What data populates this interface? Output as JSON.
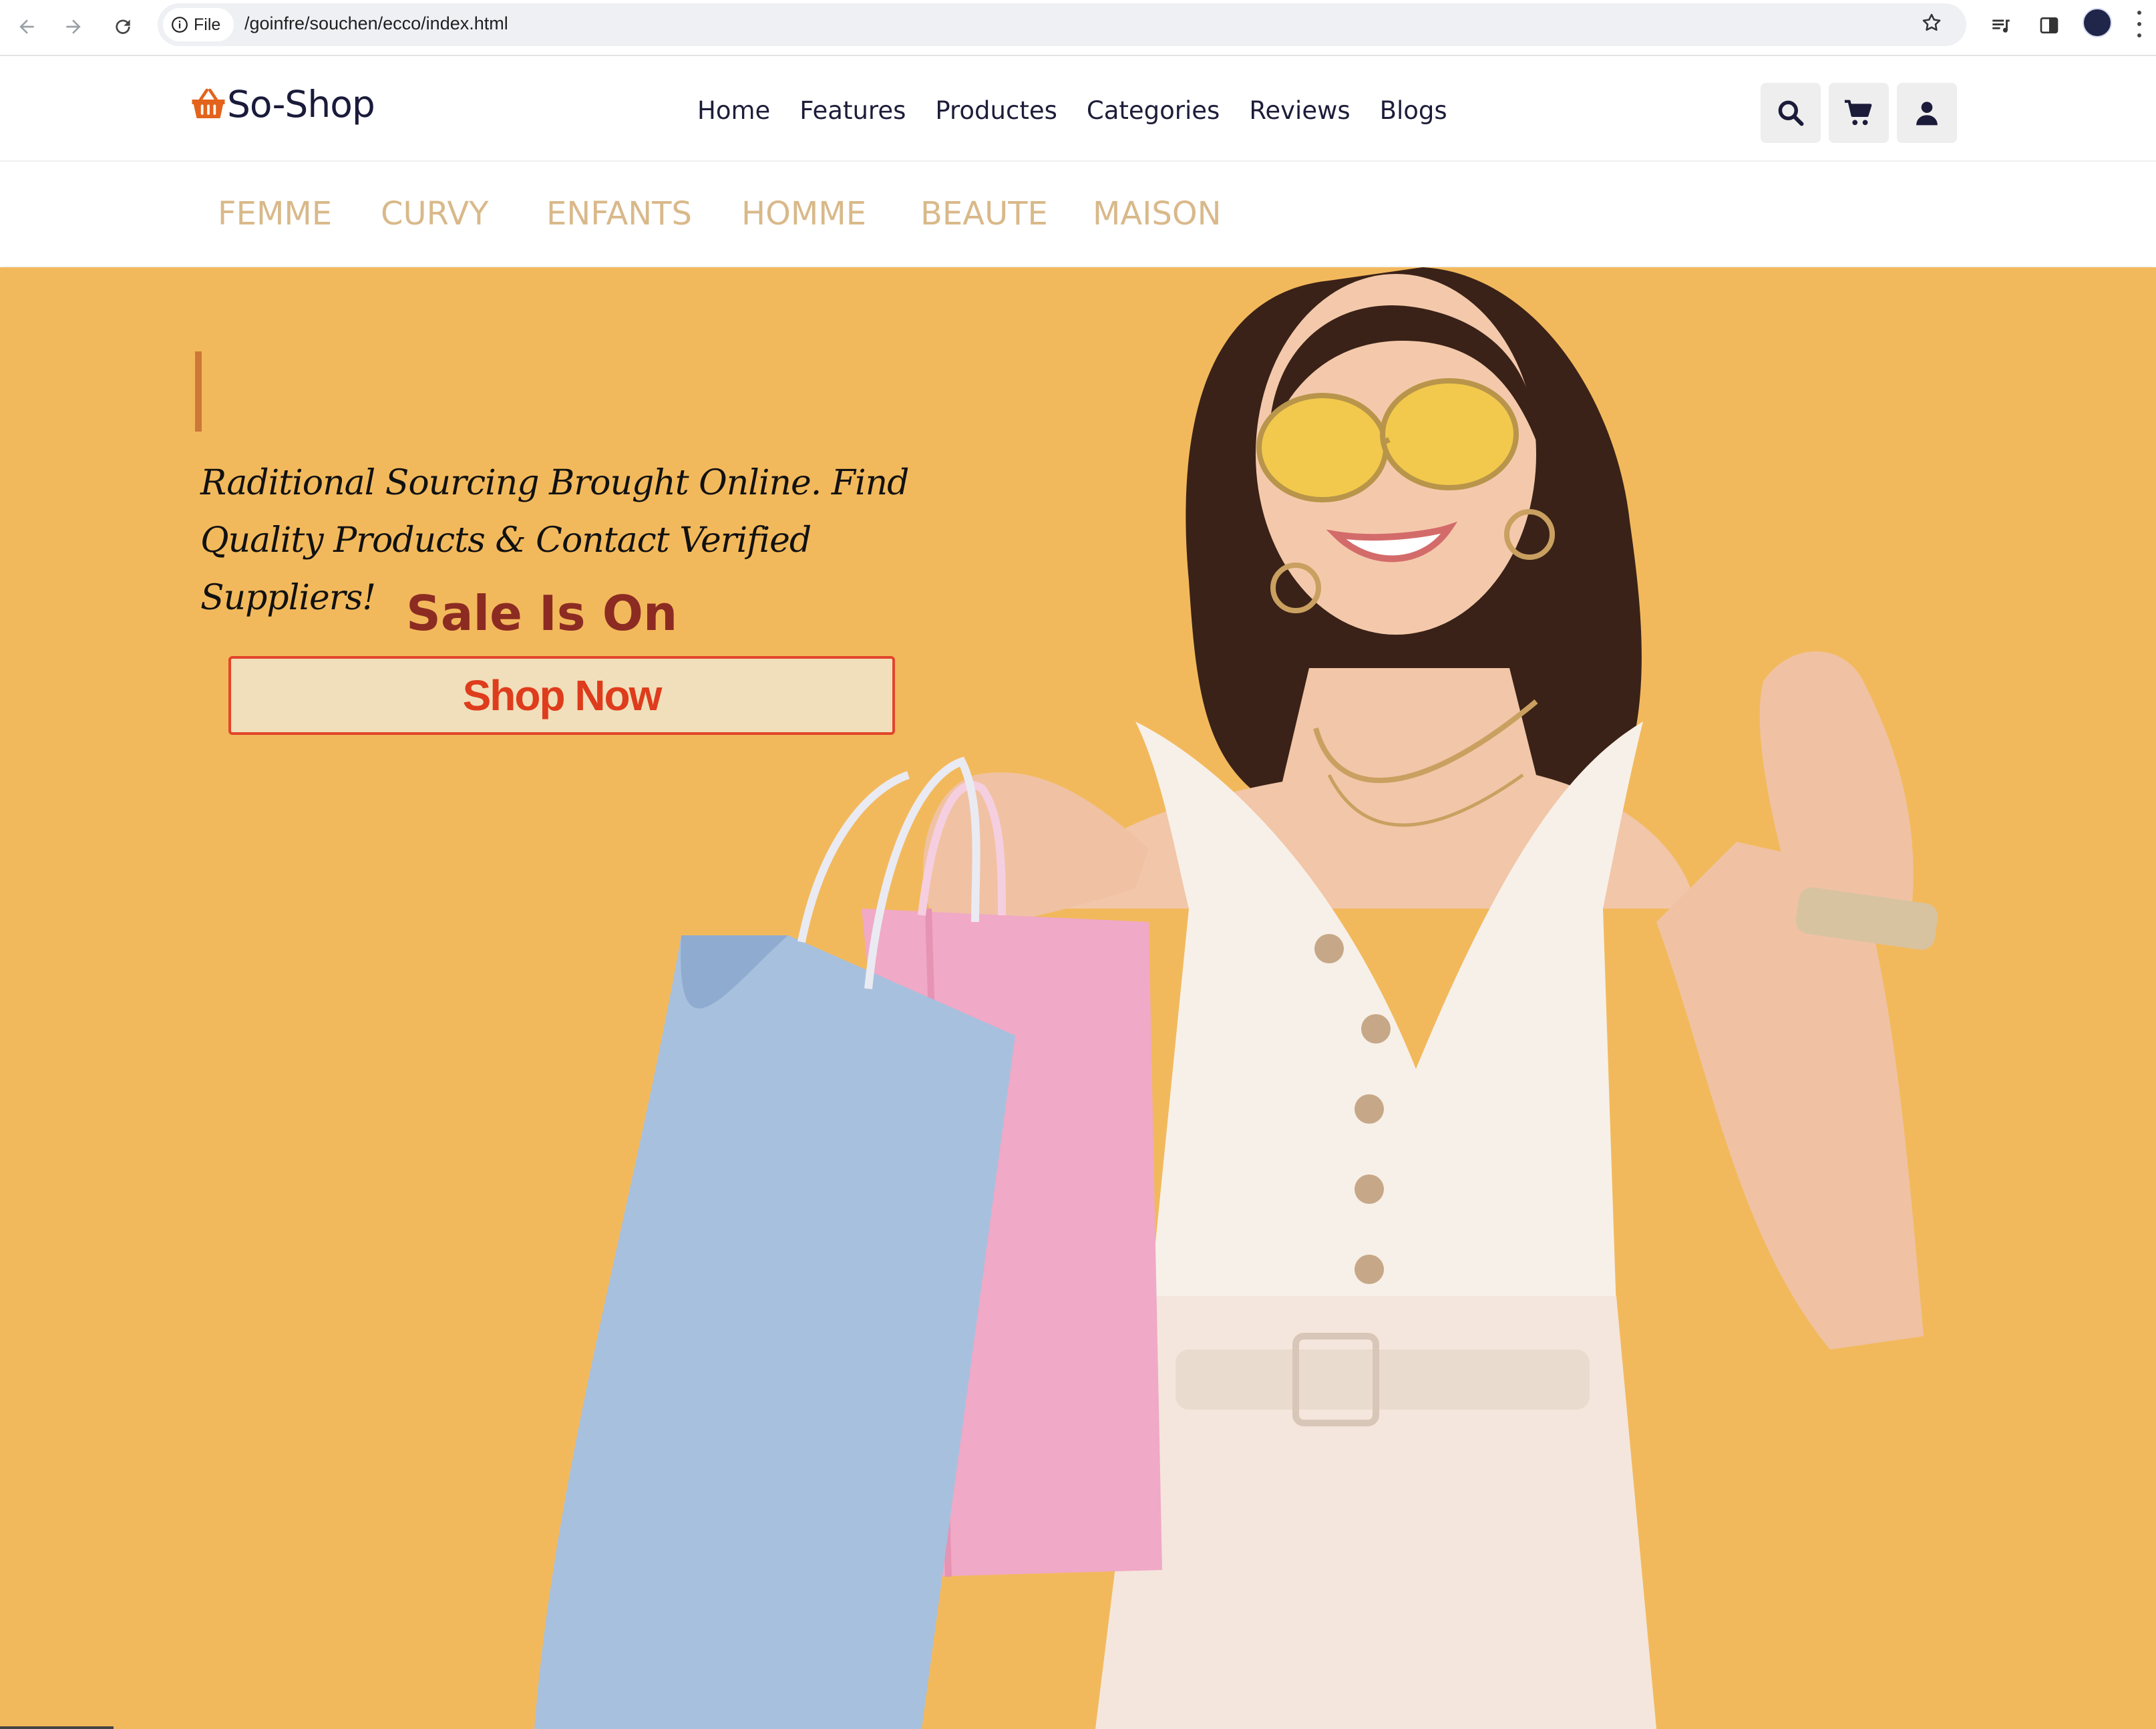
{
  "browser": {
    "site_chip": "File",
    "url": "/goinfre/souchen/ecco/index.html"
  },
  "header": {
    "logo_text": "So-Shop",
    "nav": [
      "Home",
      "Features",
      "Productes",
      "Categories",
      "Reviews",
      "Blogs"
    ]
  },
  "categories": [
    "FEMME",
    "CURVY",
    "ENFANTS",
    "HOMME",
    "BEAUTE",
    "MAISON"
  ],
  "hero": {
    "tagline_line1": "Raditional Sourcing Brought Online. Find",
    "tagline_line2": "Quality Products & Contact Verified Suppliers!",
    "sale_text": "Sale Is On",
    "cta_label": "Shop Now"
  },
  "colors": {
    "hero_background": "#f2b95c",
    "category_text": "#d9b98a",
    "sale_text": "#8c2b22",
    "cta_text": "#de3c1c",
    "cta_border": "#e2452a",
    "cta_background": "#f0dfba",
    "accent_bar": "#cc7837"
  },
  "icons": [
    "back-arrow-icon",
    "forward-arrow-icon",
    "reload-icon",
    "info-icon",
    "bookmark-star-icon",
    "reading-list-icon",
    "side-panel-icon",
    "menu-kebab-icon",
    "shopping-basket-logo-icon",
    "search-icon",
    "cart-icon",
    "user-icon"
  ]
}
